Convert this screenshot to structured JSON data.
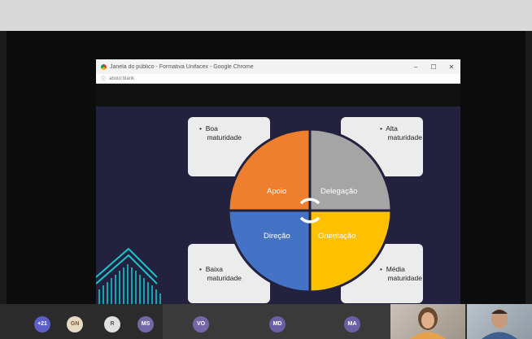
{
  "browser": {
    "title": "Janela do público - Formativa Unifacex - Google Chrome",
    "address": "about:blank",
    "controls": [
      "–",
      "☐",
      "✕"
    ]
  },
  "slide": {
    "cards": {
      "top_left": "Boa\nmaturidade",
      "top_right": "Alta\nmaturidade",
      "bottom_left": "Baixa\nmaturidade",
      "bottom_right": "Média\nmaturidade"
    },
    "quadrants": {
      "top_left": "Apoio",
      "top_right": "Delegação",
      "bottom_left": "Direção",
      "bottom_right": "Orientação"
    },
    "colors": {
      "apoio": "#ee7f2f",
      "delegacao": "#a5a5a5",
      "direcao": "#4472c4",
      "orientacao": "#ffc000",
      "background": "#22223f"
    }
  },
  "participants": {
    "more": "+21",
    "avatars": [
      {
        "initials": "GN",
        "color": "#e8d9c4"
      },
      {
        "initials": "R",
        "color": "#e0e0e0"
      },
      {
        "initials": "MS",
        "color": "#7367a8"
      },
      {
        "initials": "VO",
        "color": "#7367a8"
      },
      {
        "initials": "MD",
        "color": "#6b5fa5"
      },
      {
        "initials": "MA",
        "color": "#6b5fa5"
      }
    ]
  }
}
